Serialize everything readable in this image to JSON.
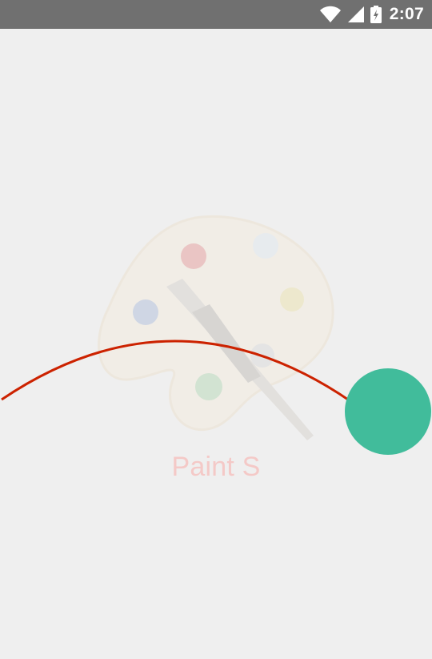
{
  "status_bar": {
    "time": "2:07",
    "icons": [
      "wifi-icon",
      "cell-signal-icon",
      "battery-charging-icon"
    ],
    "background": "#707070"
  },
  "splash": {
    "app_name": "Paint S",
    "logo_icon": "paint-palette-icon",
    "colors": {
      "arc": "#cc2200",
      "dot": "#41bc9b",
      "app_name": "#f4c9c7",
      "background": "#efefef"
    }
  }
}
